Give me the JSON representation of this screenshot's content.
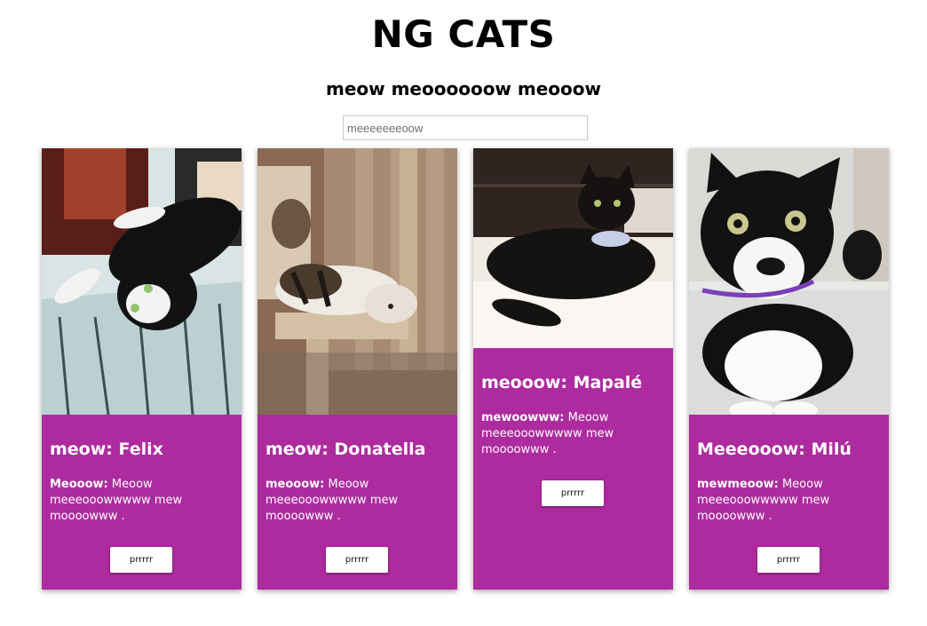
{
  "header": {
    "title": "NG CATS",
    "subtitle": "meow meoooooow meooow"
  },
  "search": {
    "placeholder": "meeeeeeeoow"
  },
  "cards": [
    {
      "title": "meow: Felix",
      "label": "Meooow:",
      "text": "Meoow meeeooowwwww mew moooowww .",
      "button": "prrrrr",
      "photo_icon": "cat-photo-felix"
    },
    {
      "title": "meow: Donatella",
      "label": "meooow:",
      "text": "Meoow meeeooowwwww mew moooowww .",
      "button": "prrrrr",
      "photo_icon": "cat-photo-donatella"
    },
    {
      "title": "meooow: Mapalé",
      "label": "mewoowww:",
      "text": "Meoow meeeooowwwww mew moooowww .",
      "button": "prrrrr",
      "photo_icon": "cat-photo-mapale"
    },
    {
      "title": "Meeeooow: Milú",
      "label": "mewmeoow:",
      "text": "Meoow meeeooowwwww mew moooowww .",
      "button": "prrrrr",
      "photo_icon": "cat-photo-milu"
    }
  ],
  "colors": {
    "card_background": "#ad2b9e",
    "button_background": "#ffffff"
  }
}
